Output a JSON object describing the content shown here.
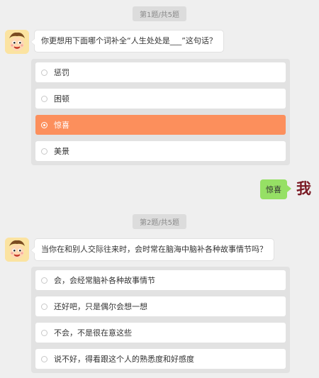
{
  "q1": {
    "counter": "第1题/共5题",
    "question": "你更想用下面哪个词补全“人生处处是___”这句话？",
    "options": [
      "惩罚",
      "困顿",
      "惊喜",
      "美景"
    ],
    "selected_index": 2
  },
  "answer": {
    "text": "惊喜",
    "user_label": "我"
  },
  "q2": {
    "counter": "第2题/共5题",
    "question": "当你在和别人交际往来时，会时常在脑海中脑补各种故事情节吗？",
    "options": [
      "会，会经常脑补各种故事情节",
      "还好吧，只是偶尔会想一想",
      "不会，不是很在意这些",
      "说不好，得看跟这个人的熟悉度和好感度"
    ]
  },
  "colors": {
    "selected": "#fc8f5c",
    "answer_bubble": "#96e065",
    "background": "#efefef"
  }
}
